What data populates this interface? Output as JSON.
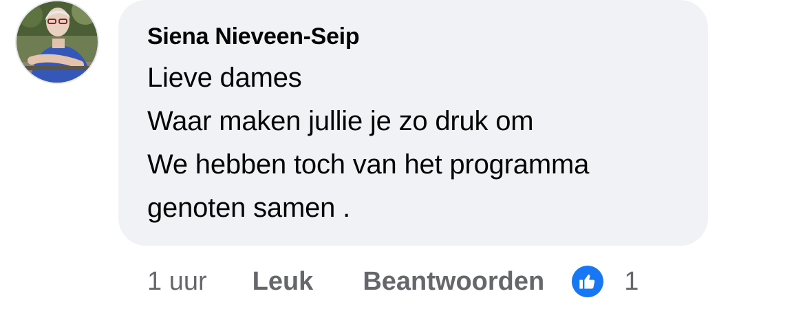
{
  "comment": {
    "author": "Siena Nieveen-Seip",
    "lines": [
      "Lieve dames",
      "Waar maken jullie je zo druk om",
      "We hebben toch van het programma",
      "genoten samen ."
    ]
  },
  "actions": {
    "time": "1 uur",
    "like_label": "Leuk",
    "reply_label": "Beantwoorden",
    "reaction_icon": "thumbs-up-icon",
    "reaction_count": "1"
  },
  "colors": {
    "bubble": "#f0f2f5",
    "text": "#050505",
    "secondary": "#65676b",
    "like_blue": "#1877f2"
  }
}
